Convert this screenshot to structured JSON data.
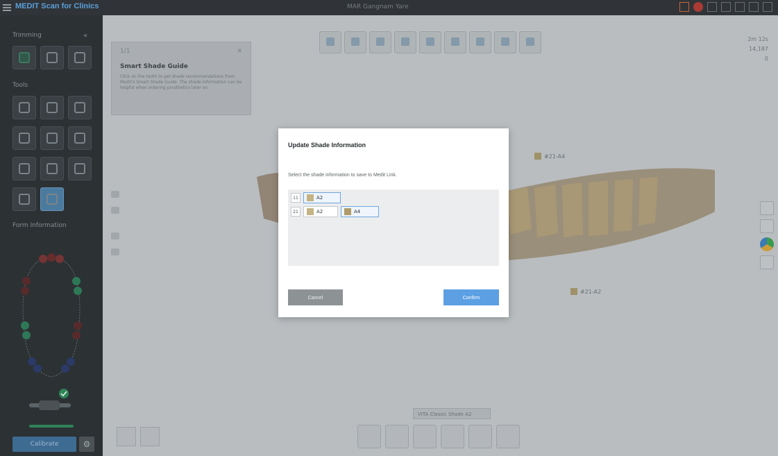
{
  "app": {
    "name": "MEDIT Scan for Clinics",
    "document_title": "MAR Gangnam Yare"
  },
  "left_panel": {
    "trimming_label": "Trimming",
    "tools_label": "Tools",
    "form_info_label": "Form Information",
    "calibrate_label": "Calibrate"
  },
  "guide": {
    "nav": "1/1",
    "title": "Smart Shade Guide",
    "text": "Click on the tooth to get shade recommendations from Medit's Smart Shade Guide. The shade information can be helpful when ordering prosthetics later on."
  },
  "stats": {
    "time": "2m 12s",
    "count": "14,187",
    "extra": "0"
  },
  "shade_tags": [
    {
      "label": "#21-A4"
    },
    {
      "label": "#21-A2"
    }
  ],
  "shade_pill": "VITA Classic Shade A2",
  "dialog": {
    "title": "Update Shade Information",
    "subtitle": "Select the shade information to save to Medit Link.",
    "rows": [
      {
        "tooth": "11",
        "shades": [
          {
            "label": "A2",
            "color": "#c4b384",
            "selected": true
          }
        ]
      },
      {
        "tooth": "21",
        "shades": [
          {
            "label": "A2",
            "color": "#c4b384",
            "selected": false
          },
          {
            "label": "A4",
            "color": "#b09b6b",
            "selected": true
          }
        ]
      }
    ],
    "cancel_label": "Cancel",
    "confirm_label": "Confirm"
  },
  "colors": {
    "accent": "#5c9fe3",
    "sidebar": "#2b3033",
    "viewport": "#c4c8cb"
  }
}
